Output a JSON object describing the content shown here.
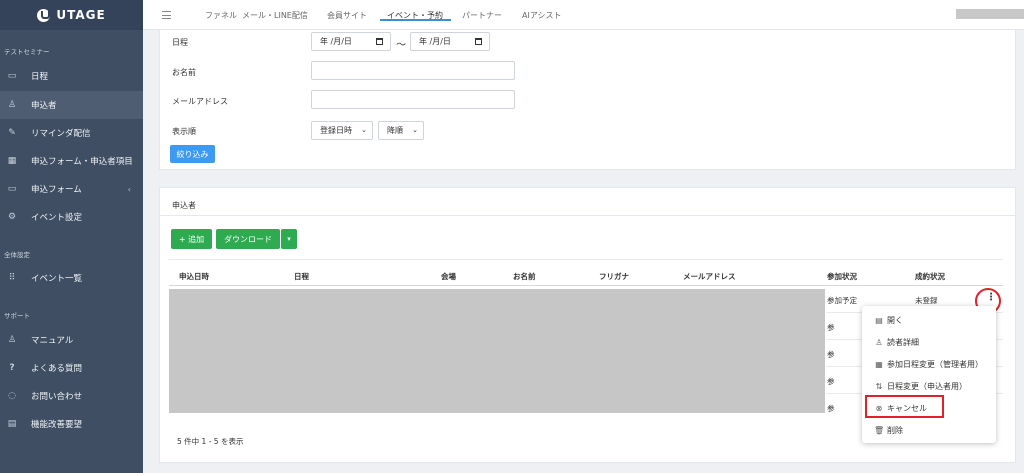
{
  "brand": "UTAGE",
  "sidebar": {
    "section1": "テストセミナー",
    "items1": [
      {
        "label": "日程",
        "icon": "calendar-icon"
      },
      {
        "label": "申込者",
        "icon": "person-icon"
      },
      {
        "label": "リマインダ配信",
        "icon": "pencil-icon"
      },
      {
        "label": "申込フォーム・申込者項目",
        "icon": "table-icon"
      },
      {
        "label": "申込フォーム",
        "icon": "form-icon"
      },
      {
        "label": "イベント設定",
        "icon": "gear-icon"
      }
    ],
    "section2": "全体設定",
    "items2": [
      {
        "label": "イベント一覧",
        "icon": "sitemap-icon"
      }
    ],
    "section3": "サポート",
    "items3": [
      {
        "label": "マニュアル",
        "icon": "person-icon"
      },
      {
        "label": "よくある質問",
        "icon": "question-icon"
      },
      {
        "label": "お問い合わせ",
        "icon": "chat-icon"
      },
      {
        "label": "機能改善要望",
        "icon": "document-icon"
      }
    ],
    "active_label": "申込者"
  },
  "topnav": {
    "tabs": [
      "ファネル",
      "メール・LINE配信",
      "会員サイト",
      "イベント・予約",
      "パートナー",
      "AIアシスト"
    ],
    "active": "イベント・予約"
  },
  "search": {
    "date_label": "日程",
    "date_from": "年 /月/日",
    "date_sep": "〜",
    "date_to": "年 /月/日",
    "name_label": "お名前",
    "name_value": "",
    "email_label": "メールアドレス",
    "email_value": "",
    "order_label": "表示順",
    "order_by": "登録日時",
    "order_dir": "降順",
    "filter_button": "絞り込み"
  },
  "applicants": {
    "title": "申込者",
    "add_button": "+ 追加",
    "download_button": "ダウンロード",
    "columns": [
      "申込日時",
      "日程",
      "会場",
      "お名前",
      "フリガナ",
      "メールアドレス",
      "参加状況",
      "成約状況"
    ],
    "first_row": {
      "status": "参加予定",
      "contract": "未登録"
    },
    "partial_cells": [
      "参",
      "参",
      "参",
      "参"
    ],
    "footer": "5 件中 1 - 5 を表示"
  },
  "row_menu": {
    "items": [
      {
        "label": "開く",
        "icon": "document-icon"
      },
      {
        "label": "読者詳細",
        "icon": "person-icon"
      },
      {
        "label": "参加日程変更（管理者用）",
        "icon": "calendar-icon"
      },
      {
        "label": "日程変更（申込者用）",
        "icon": "swap-icon"
      },
      {
        "label": "キャンセル",
        "icon": "cancel-circle-icon"
      },
      {
        "label": "削除",
        "icon": "trash-icon"
      }
    ]
  }
}
